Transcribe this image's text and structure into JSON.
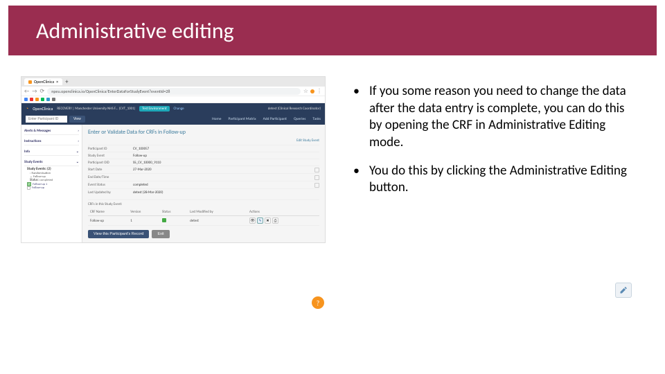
{
  "title": "Administrative editing",
  "bullets": [
    "If you some reason you need to change the data after the data entry is complete, you can do this by opening the CRF in Administrative Editing mode.",
    "You do this by clicking the Administrative Editing button."
  ],
  "browser": {
    "tab_title": "OpenClinica",
    "url": "npeu.openclinica.io/OpenClinica/EnterDataForStudyEvent?eventId=28",
    "app_name": "OpenClinica",
    "study": "RECOVERY | Manchester University NHS F... (CVT_1001)",
    "env": "Test Environment",
    "change": "Change",
    "role": "detest (Clinical Research Coordinator)",
    "pid_placeholder": "Enter Participant ID",
    "view_btn": "View",
    "nav": {
      "home": "Home",
      "matrix": "Participant Matrix",
      "add": "Add Participant",
      "queries": "Queries",
      "tasks": "Tasks"
    }
  },
  "sidebar": {
    "instructions": "Instructions",
    "info": "Info",
    "alerts": "Alerts & Messages",
    "events_head": "Study Events",
    "events_count": "Study Events: (2)",
    "rand": "Randomisation",
    "fu": "Follow-up",
    "status_label": "Status:",
    "status_val": "completed",
    "fu1": "Follow-up 1",
    "fu2": "Follow-up"
  },
  "main": {
    "page_title": "Enter or Validate Data for CRFs in Follow-up",
    "edit_link": "Edit Study Event",
    "fields": {
      "pid_l": "Participant ID",
      "pid_v": "CV_100057",
      "se_l": "Study Event",
      "se_v": "Follow-up",
      "poid_l": "Participant OID",
      "poid_v": "SS_CV_10000_9110",
      "sd_l": "Start Date",
      "sd_v": "27-Mar-2020",
      "ed_l": "End Date/Time",
      "ed_v": "",
      "es_l": "Event Status",
      "es_v": "completed",
      "lu_l": "Last Updated by",
      "lu_v": "detest (28-Mar-2020)"
    },
    "crf_section": "CRFs in this Study Event:",
    "cols": {
      "name": "CRF Name",
      "version": "Version",
      "status": "Status",
      "modby": "Last Modified by",
      "actions": "Actions"
    },
    "row": {
      "name": "Follow-up",
      "version": "1",
      "modby": "detest"
    },
    "vpr": "View this Participant's Record",
    "exit": "Exit"
  },
  "help": "?"
}
